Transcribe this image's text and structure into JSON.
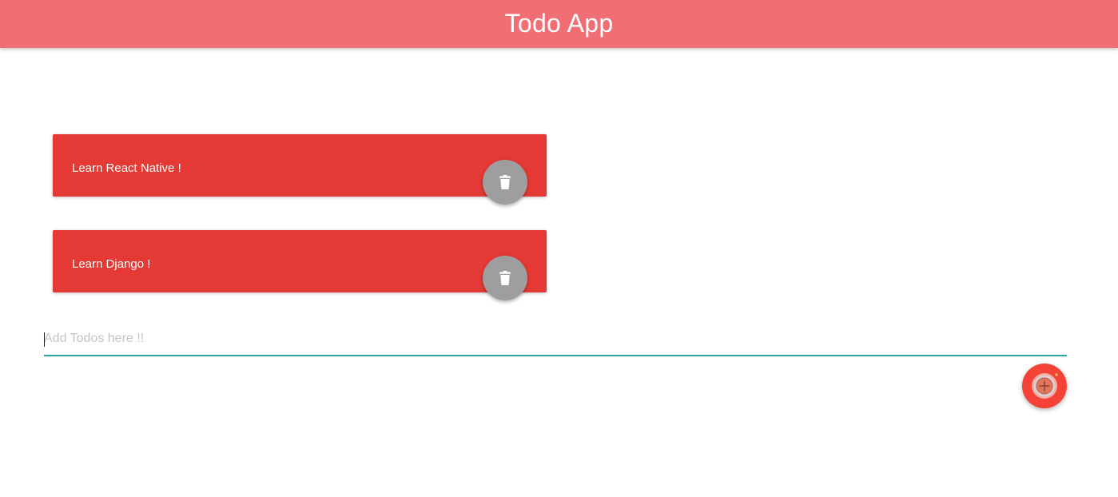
{
  "header": {
    "title": "Todo App",
    "color": "#f06e74"
  },
  "todos": [
    {
      "text": "Learn React Native !",
      "icon": "trash-icon"
    },
    {
      "text": "Learn Django !",
      "icon": "trash-icon"
    }
  ],
  "input": {
    "value": "",
    "placeholder": "Add Todos here !!"
  },
  "add_button": {
    "icon": "add-circle-icon"
  },
  "colors": {
    "card": "#e53935",
    "delete_button": "#9e9e9e",
    "add_button": "#f44336",
    "input_underline": "#26a69a"
  }
}
